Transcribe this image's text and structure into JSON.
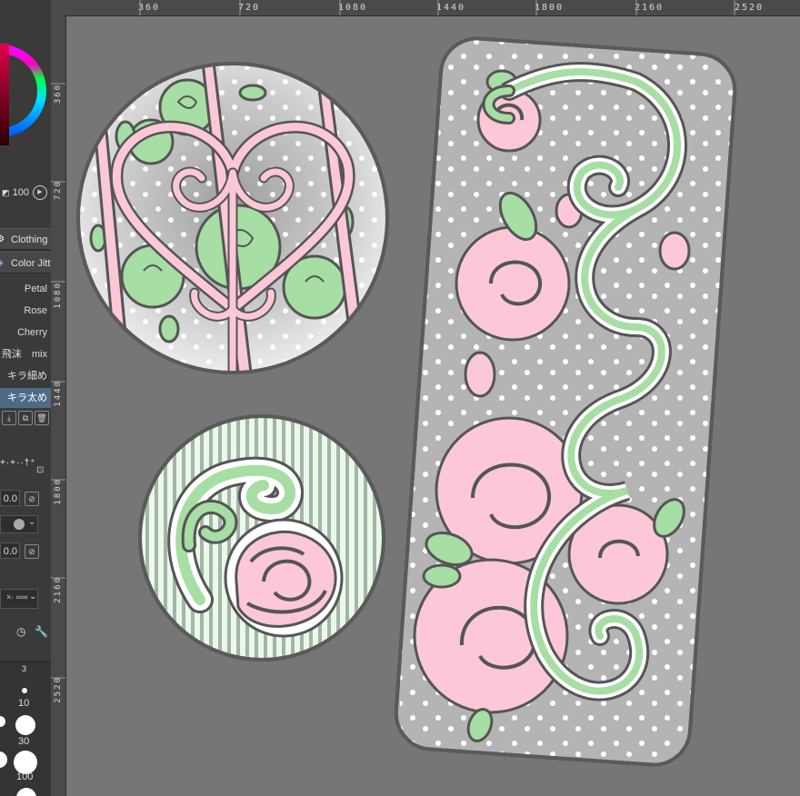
{
  "rulers": {
    "top_labels": [
      "360",
      "720",
      "1080",
      "1440",
      "1800",
      "2160",
      "2520"
    ],
    "left_labels": [
      "360",
      "720",
      "1080",
      "1440",
      "1800",
      "2160",
      "2520"
    ]
  },
  "sidebar": {
    "color_wheel_value": "100",
    "tabs": [
      {
        "label": "Clothing"
      },
      {
        "label": "Color Jitt"
      }
    ],
    "brush_list": [
      {
        "label": "Petal"
      },
      {
        "label": "Rose"
      },
      {
        "label": "Cherry"
      },
      {
        "label": "飛沫　mix"
      },
      {
        "label": "キラ細め"
      },
      {
        "label": "キラ太め",
        "selected": true
      }
    ],
    "field1": "0.0",
    "field2": "0.0",
    "size_header": "3",
    "brush_sizes": [
      "10",
      "30",
      "100"
    ]
  },
  "colors": {
    "canvas_bg": "#767676",
    "panel_bg": "#3a3a3a",
    "ruler_bg": "#4a4a4a",
    "pink": "#fcc8d8",
    "green": "#a6dea4",
    "outline": "#555555",
    "gray_fill": "#b4b4b4",
    "selection": "#4e6a86"
  }
}
